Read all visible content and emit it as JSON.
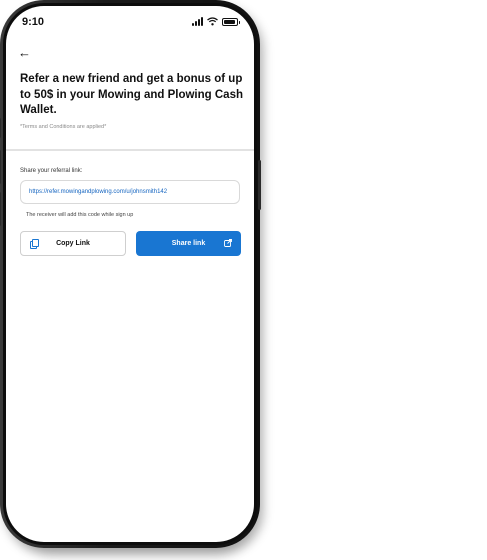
{
  "status_bar": {
    "time": "9:10"
  },
  "nav": {
    "back_glyph": "←"
  },
  "headline": "Refer a new friend and get a bonus of up to 50$ in your Mowing and Plowing Cash Wallet.",
  "terms_note": "*Terms and Conditions are applied*",
  "referral": {
    "label": "Share your referral link:",
    "link": "https://refer.mowingandplowing.com/u/johnsmith142",
    "helper": "The receiver will add this code while sign up"
  },
  "actions": {
    "copy_label": "Copy Link",
    "share_label": "Share link"
  },
  "colors": {
    "accent": "#1976d2",
    "link_text": "#1565c0"
  },
  "icons": {
    "back": "back-arrow-icon",
    "copy": "copy-icon",
    "share": "share-external-icon",
    "signal": "cellular-signal-icon",
    "wifi": "wifi-icon",
    "battery": "battery-icon"
  }
}
